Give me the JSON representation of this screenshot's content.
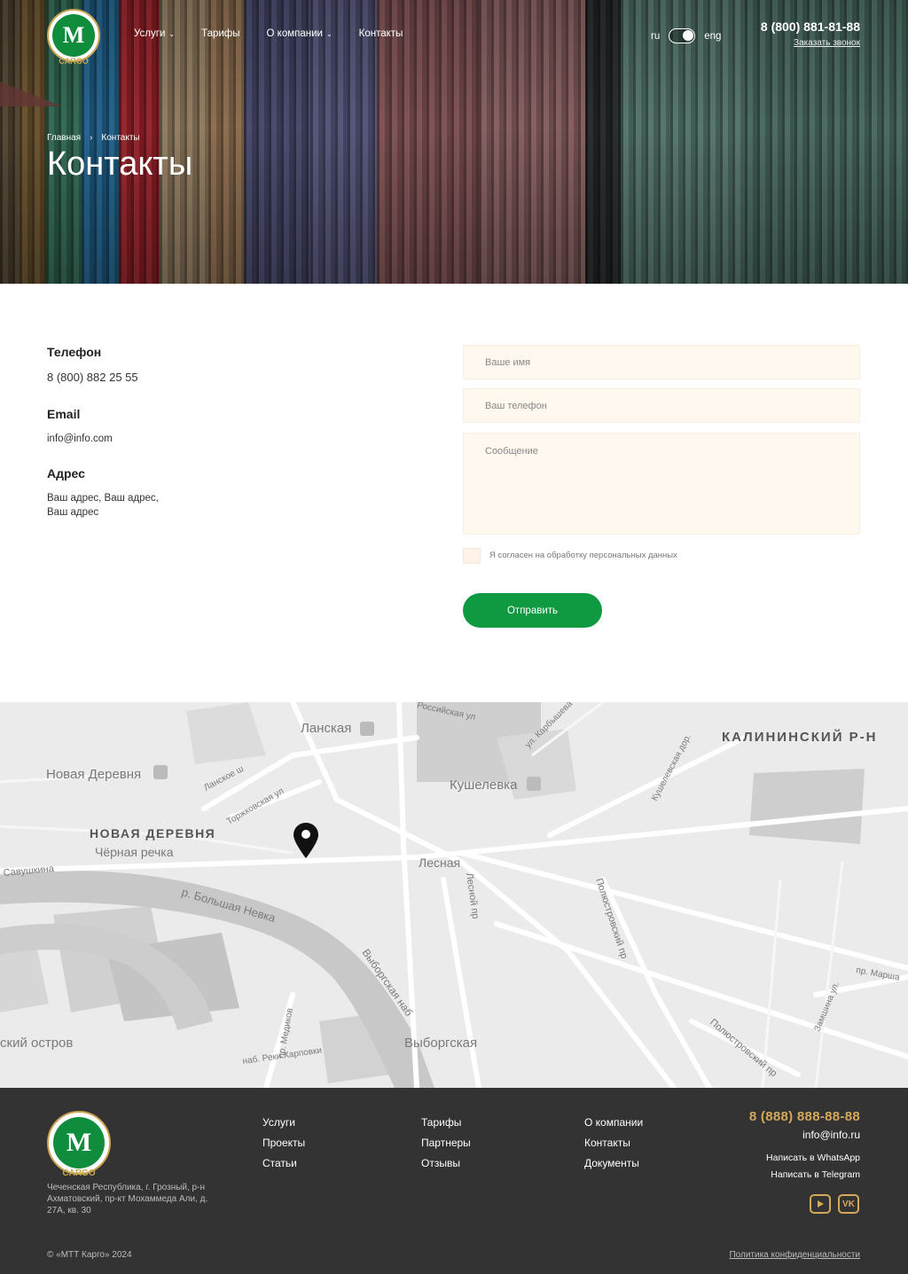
{
  "header": {
    "logo_text": "CARGO",
    "nav": [
      {
        "label": "Услуги",
        "has_dropdown": true
      },
      {
        "label": "Тарифы",
        "has_dropdown": false
      },
      {
        "label": "О компании",
        "has_dropdown": true
      },
      {
        "label": "Контакты",
        "has_dropdown": false
      }
    ],
    "lang_ru": "ru",
    "lang_eng": "eng",
    "phone": "8 (800) 881-81-88",
    "callback_link": "Заказать звонок"
  },
  "hero": {
    "breadcrumb_home": "Главная",
    "breadcrumb_sep": "›",
    "breadcrumb_current": "Контакты",
    "title": "Контакты"
  },
  "contacts": {
    "phone_label": "Телефон",
    "phone_value": "8 (800) 882 25 55",
    "email_label": "Email",
    "email_value": "info@info.com",
    "address_label": "Адрес",
    "address_line1": "Ваш адрес, Ваш адрес,",
    "address_line2": "Ваш адрес"
  },
  "form": {
    "name_placeholder": "Ваше имя",
    "phone_placeholder": "Ваш телефон",
    "message_placeholder": "Сообщение",
    "consent": "Я согласен на обработку персональных данных",
    "submit": "Отправить"
  },
  "map": {
    "labels": {
      "lanskaya": "Ланская",
      "novaya_derevnya_station": "Новая Деревня",
      "novaya_derevnya_district": "НОВАЯ ДЕРЕВНЯ",
      "chernaya_rechka": "Чёрная речка",
      "kalininsky": "КАЛИНИНСКИЙ Р-Н",
      "kushelevka": "Кушелевка",
      "lesnaya": "Лесная",
      "vyborgskaya": "Выборгская",
      "savushkina": "Савушкина",
      "bolshaya_nevka": "р. Большая Невка",
      "vyborgskaya_nab": "Выборгская наб",
      "lesnoy_pr": "Лесной пр",
      "polyustrovsky_pr": "Полюстровский пр",
      "polyustrovsky_pr2": "Полюстровский пр",
      "kushelevskaya_dor": "Кушелевская дор.",
      "karbysheva": "ул. Карбышева",
      "rossiyskaya": "Российская ул",
      "lanskoe_sh": "Ланское ш",
      "torzhkovskaya": "Торжковская ул",
      "medikov": "пр. Медиков",
      "reki_karpovki": "наб. Реки Карповки",
      "ostrov": "ский остров",
      "zamshina": "Замшина ул.",
      "marshala": "пр. Марша"
    },
    "marker": "map-pin"
  },
  "footer": {
    "logo_text": "CARGO",
    "address": "Чеченская Республика, г. Грозный, р-н Ахматовский, пр-кт Мохаммеда Али, д. 27А, кв. 30",
    "col1": [
      "Услуги",
      "Проекты",
      "Статьи"
    ],
    "col2": [
      "Тарифы",
      "Партнеры",
      "Отзывы"
    ],
    "col3": [
      "О компании",
      "Контакты",
      "Документы"
    ],
    "phone": "8 (888) 888-88-88",
    "email": "info@info.ru",
    "whatsapp": "Написать в WhatsApp",
    "telegram": "Написать в Telegram",
    "vk_label": "VK",
    "copyright": "© «МТТ Карго» 2024",
    "policy": "Политика конфиденциальности"
  },
  "colors": {
    "accent_green": "#0f9a42",
    "gold": "#d5a85a",
    "footer_bg": "#333333",
    "input_bg": "#fef8ee"
  }
}
